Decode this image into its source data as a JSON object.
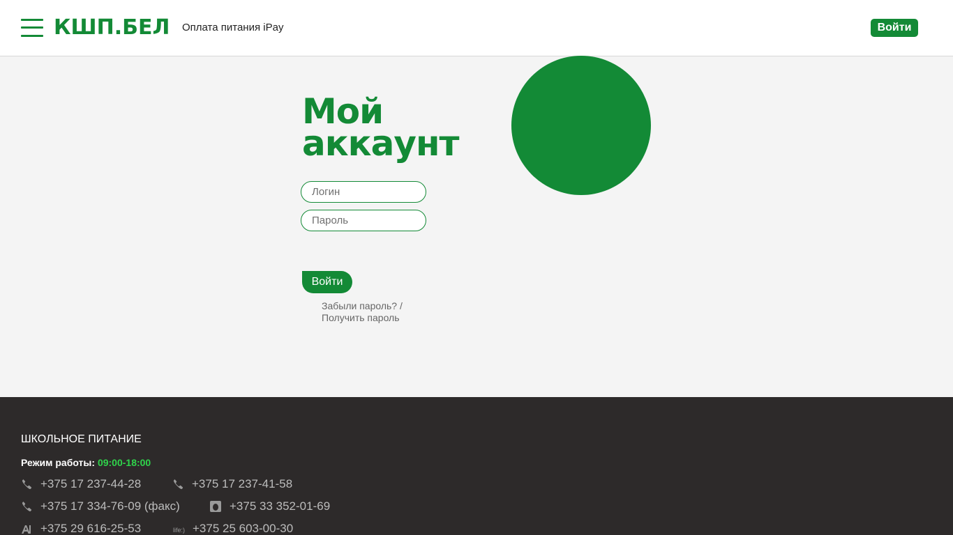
{
  "header": {
    "logo": "КШП.БЕЛ",
    "nav_link": "Оплата питания iPay",
    "login_button": "Войти"
  },
  "main": {
    "title_line1": "Мой",
    "title_line2": "аккаунт",
    "login_placeholder": "Логин",
    "password_placeholder": "Пароль",
    "submit_label": "Войти",
    "forgot_link": "Забыли пароль? /",
    "get_password_link": "Получить пароль"
  },
  "footer": {
    "title": "ШКОЛЬНОЕ ПИТАНИЕ",
    "hours_label": "Режим работы:",
    "hours_value": "09:00-18:00",
    "life_label": "life:)",
    "phones": [
      {
        "number": "+375 17 237-44-28",
        "icon": "phone-icon"
      },
      {
        "number": "+375 17 237-41-58",
        "icon": "phone-icon"
      },
      {
        "number": "+375 17 334-76-09 (факс)",
        "icon": "phone-icon"
      },
      {
        "number": "+375 33 352-01-69",
        "icon": "mts-icon"
      },
      {
        "number": "+375 29 616-25-53",
        "icon": "a1-icon"
      },
      {
        "number": "+375 25 603-00-30",
        "icon": "life-icon"
      }
    ]
  },
  "colors": {
    "brand_green": "#138a36",
    "footer_bg": "#2d2a2a",
    "hours_green": "#2fd44b"
  }
}
